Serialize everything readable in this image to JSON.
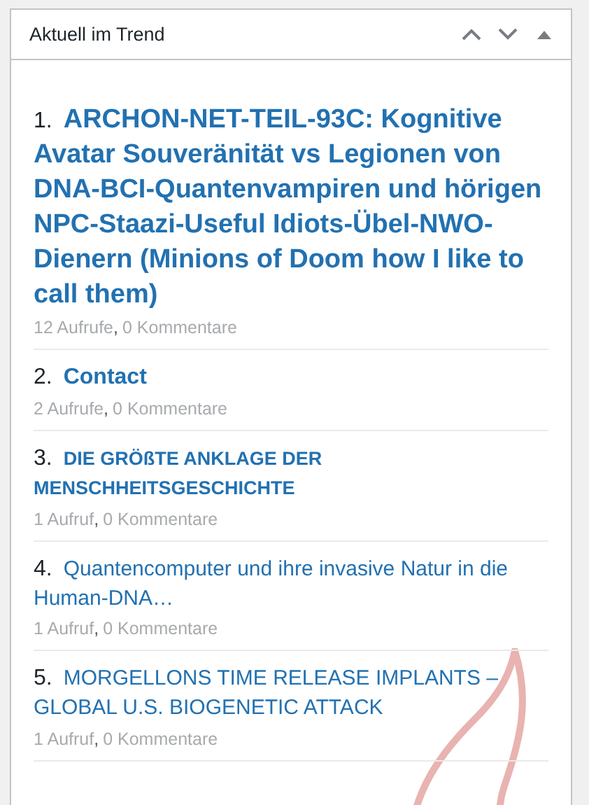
{
  "widget": {
    "title": "Aktuell im Trend"
  },
  "posts": [
    {
      "number": "1.",
      "title": "ARCHON-NET-TEIL-93C: Kognitive Avatar Souveränität vs Legionen von DNA-BCI-Quantenvampiren und hörigen NPC-Staazi-Useful Idiots-Übel-NWO-Dienern (Minions of Doom how I like to call them)",
      "kind": "large",
      "views": "12 Aufrufe",
      "separator": ",",
      "comments": "0 Kommentare"
    },
    {
      "number": "2.",
      "title": "Contact",
      "kind": "bold",
      "views": "2 Aufrufe",
      "separator": ",",
      "comments": "0 Kommentare"
    },
    {
      "number": "3.",
      "title": "DIE GRÖßTE ANKLAGE DER MENSCHHEITSGESCHICHTE",
      "kind": "small",
      "views": "1 Aufruf",
      "separator": ",",
      "comments": "0 Kommentare"
    },
    {
      "number": "4.",
      "title": "Quantencomputer und ihre invasive Natur in die Human-DNA…",
      "kind": "plain",
      "views": "1 Aufruf",
      "separator": ",",
      "comments": "0 Kommentare"
    },
    {
      "number": "5.",
      "title": "MORGELLONS TIME RELEASE IMPLANTS – GLOBAL U.S. BIOGENETIC ATTACK",
      "kind": "plain",
      "views": "1 Aufruf",
      "separator": ",",
      "comments": "0 Kommentare"
    }
  ]
}
